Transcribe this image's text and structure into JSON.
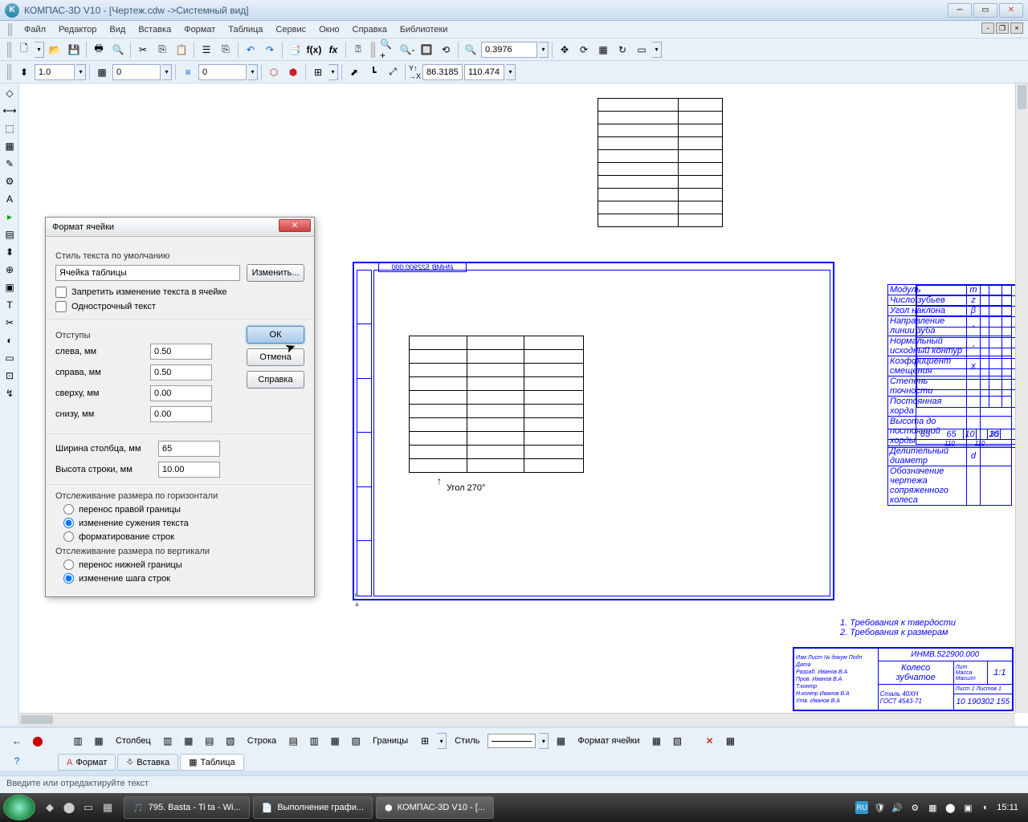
{
  "window": {
    "title": "КОМПАС-3D V10 - [Чертеж.cdw ->Системный вид]"
  },
  "menu": [
    "Файл",
    "Редактор",
    "Вид",
    "Вставка",
    "Формат",
    "Таблица",
    "Сервис",
    "Окно",
    "Справка",
    "Библиотеки"
  ],
  "toolbar_values": {
    "scale": "1.0",
    "num1": "0",
    "num2": "0",
    "zoom": "0.3976",
    "coord_x": "86.3185",
    "coord_y": "110.474"
  },
  "canvas": {
    "designation": "ИНМВ 522900.000",
    "angle_label": "Угол 270°",
    "requirements": [
      "1. Требования к твердости",
      "2. Требования к размерам"
    ],
    "param_rows": [
      [
        "Модуль",
        "m",
        ""
      ],
      [
        "Число зубьев",
        "z",
        ""
      ],
      [
        "Угол наклона",
        "β",
        ""
      ],
      [
        "Направление линии зуба",
        "-",
        ""
      ],
      [
        "Нормальный исходный контур",
        "-",
        ""
      ],
      [
        "Коэффициент смещения",
        "x",
        ""
      ],
      [
        "Степень точности",
        "",
        ""
      ],
      [
        "Постоянная хорда",
        "",
        ""
      ],
      [
        "Высота до постоянной хорды",
        "",
        ""
      ],
      [
        "Делительный диаметр",
        "d",
        ""
      ],
      [
        "Обозначение чертежа сопряженного колеса",
        "",
        ""
      ]
    ],
    "dims": {
      "a": "65",
      "b": "10",
      "c": "35",
      "total": "110"
    },
    "title_block": {
      "code": "ИНМВ.522900.000",
      "name1": "Колесо",
      "name2": "зубчатое",
      "material": "Сталь 40ХН\nГОСТ 4543-71",
      "scale": "1:1",
      "sheet": "10 190302 155"
    }
  },
  "dialog": {
    "title": "Формат ячейки",
    "style_label": "Стиль текста по умолчанию",
    "style_value": "Ячейка таблицы",
    "change_btn": "Изменить...",
    "chk1": "Запретить изменение текста в ячейке",
    "chk2": "Однострочный текст",
    "indents_label": "Отступы",
    "left": {
      "label": "слева, мм",
      "val": "0.50"
    },
    "right": {
      "label": "справа, мм",
      "val": "0.50"
    },
    "top": {
      "label": "сверху, мм",
      "val": "0.00"
    },
    "bottom": {
      "label": "снизу, мм",
      "val": "0.00"
    },
    "col_width": {
      "label": "Ширина столбца, мм",
      "val": "65"
    },
    "row_height": {
      "label": "Высота строки, мм",
      "val": "10.00"
    },
    "ok": "ОК",
    "cancel": "Отмена",
    "help": "Справка",
    "track_h": "Отслеживание размера по горизонтали",
    "h_opts": [
      "перенос правой границы",
      "изменение сужения текста",
      "форматирование строк"
    ],
    "track_v": "Отслеживание размера по вертикали",
    "v_opts": [
      "перенос нижней границы",
      "изменение шага строк"
    ]
  },
  "bottom": {
    "col_label": "Столбец",
    "row_label": "Строка",
    "border_label": "Границы",
    "style_label": "Стиль",
    "format_label": "Формат ячейки",
    "tabs": [
      "Формат",
      "Вставка",
      "Таблица"
    ]
  },
  "status": "Введите или отредактируйте текст",
  "taskbar": {
    "items": [
      "795. Basta - Ti ta - Wi...",
      "Выполнение графи...",
      "КОМПАС-3D V10 - [..."
    ],
    "lang": "RU",
    "time": "15:11"
  }
}
